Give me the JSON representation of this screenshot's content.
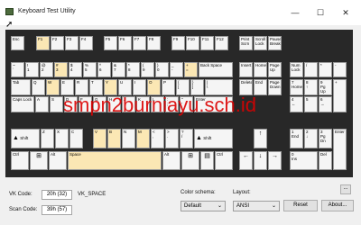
{
  "window": {
    "title": "Keyboard Test Utility",
    "minimize": "—",
    "maximize": "☐",
    "close": "✕"
  },
  "keys": {
    "esc": "Esc",
    "f1": "F1",
    "f2": "F2",
    "f3": "F3",
    "f4": "F4",
    "f5": "F5",
    "f6": "F6",
    "f7": "F7",
    "f8": "F8",
    "f9": "F9",
    "f10": "F10",
    "f11": "F11",
    "f12": "F12",
    "prtscn": "Print\nScrn",
    "scrlk": "Scroll\nLock",
    "pause": "Pause\nBreak",
    "grave": "~\n`",
    "d1": "!\n1",
    "d2": "@\n2",
    "d3": "#\n3",
    "d4": "$\n4",
    "d5": "%\n5",
    "d6": "^\n6",
    "d7": "&\n7",
    "d8": "*\n8",
    "d9": "(\n9",
    "d0": ")\n0",
    "minus": "_\n-",
    "equals": "+\n=",
    "backspace": "Back Space",
    "insert": "Insert",
    "home": "Home",
    "pgup": "Page\nUp",
    "numlock": "Num\nLock",
    "npdiv": "/",
    "npmul": "*",
    "npsub": "-",
    "tab": "Tab",
    "q": "Q",
    "w": "W",
    "e": "E",
    "r": "R",
    "t": "T",
    "y": "Y",
    "u": "U",
    "i": "I",
    "o": "O",
    "p": "P",
    "lbr": "{\n[",
    "rbr": "}\n]",
    "bslash": "|\n\\",
    "delete": "Delete",
    "end": "End",
    "pgdn": "Page\nDown",
    "np7": "7\nHome",
    "np8": "8\n↑",
    "np9": "9\nPg Up",
    "npadd": "+",
    "caps": "Caps Lock",
    "a": "A",
    "s": "S",
    "d": "D",
    "f": "F",
    "g": "G",
    "h": "H",
    "j": "J",
    "k": "K",
    "l": "L",
    "semi": ":\n;",
    "quote": "\"\n'",
    "enter": "Enter",
    "np4": "4\n←",
    "np5": "5",
    "np6": "6\n→",
    "lshift": "Shift",
    "z": "Z",
    "x": "X",
    "c": "C",
    "v": "V",
    "b": "B",
    "n": "N",
    "m": "M",
    "comma": "<\n,",
    "period": ">\n.",
    "slash": "?\n/",
    "rshift": "Shift",
    "up": "↑",
    "np1": "1\nEnd",
    "np2": "2\n↓",
    "np3": "3\nPg Dn",
    "npenter": "Enter",
    "lctrl": "Ctrl",
    "lwin": "⊞",
    "lalt": "Alt",
    "space": "Space",
    "ralt": "Alt",
    "rwin": "⊞",
    "menu": "▤",
    "rctrl": "Ctrl",
    "left": "←",
    "down": "↓",
    "right": "→",
    "np0": "0\nIns",
    "npdot": "Del"
  },
  "status": {
    "vk_label": "VK Code:",
    "vk_value": "20h (32)",
    "vk_name": "VK_SPACE",
    "scan_label": "Scan Code:",
    "scan_value": "39h (57)",
    "color_label": "Color schema:",
    "color_value": "Default",
    "layout_label": "Layout:",
    "layout_value": "ANSI",
    "reset": "Reset",
    "about": "About...",
    "more": "..."
  },
  "watermark": "smpn2burniayu.sch.id"
}
